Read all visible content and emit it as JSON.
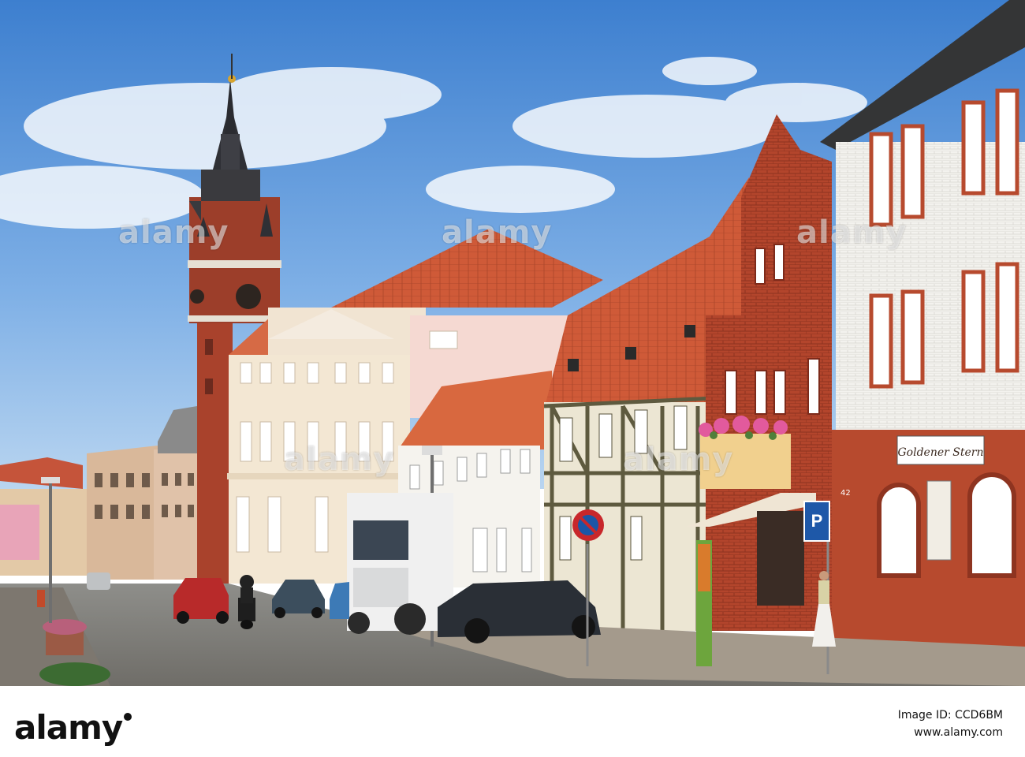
{
  "watermark": {
    "text": "alamy"
  },
  "footer": {
    "brand": "alamy",
    "image_id_label": "Image ID: CCD6BM",
    "site": "www.alamy.com"
  },
  "signs": {
    "shop_sign": "Goldener Stern",
    "parking": "P",
    "house_number": "42"
  }
}
